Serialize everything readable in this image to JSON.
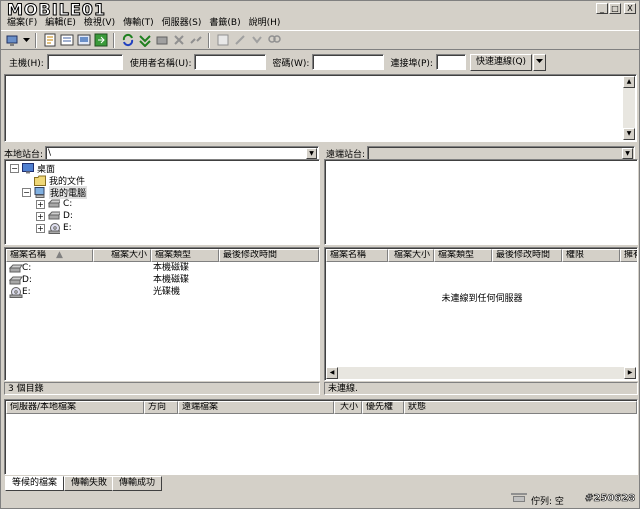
{
  "window": {
    "logo": "MOBILE01",
    "controls": [
      "_",
      "□",
      "X"
    ]
  },
  "menu": [
    "檔案(F)",
    "編輯(E)",
    "檢視(V)",
    "傳輸(T)",
    "伺服器(S)",
    "書籤(B)",
    "說明(H)"
  ],
  "quickconnect": {
    "host_label": "主機(H):",
    "user_label": "使用者名稱(U):",
    "pass_label": "密碼(W):",
    "port_label": "連接埠(P):",
    "connect_button": "快速連線(Q)"
  },
  "local": {
    "site_label": "本地站台:",
    "path": "\\",
    "tree": [
      {
        "label": "桌面",
        "icon": "desktop-icon",
        "expander": "⊟"
      },
      {
        "label": "我的文件",
        "icon": "folder-icon",
        "expander": ""
      },
      {
        "label": "我的電腦",
        "icon": "computer-icon",
        "expander": "⊟"
      },
      {
        "label": "C:",
        "icon": "drive-icon",
        "expander": "+"
      },
      {
        "label": "D:",
        "icon": "drive-icon",
        "expander": "+"
      },
      {
        "label": "E:",
        "icon": "cdrom-icon",
        "expander": "+"
      }
    ],
    "columns": [
      "檔案名稱",
      "檔案大小",
      "檔案類型",
      "最後修改時間"
    ],
    "files": [
      {
        "name": "C:",
        "type": "本機磁碟"
      },
      {
        "name": "D:",
        "type": "本機磁碟"
      },
      {
        "name": "E:",
        "type": "光碟機"
      }
    ],
    "status": "3 個目錄"
  },
  "remote": {
    "site_label": "遠端站台:",
    "columns": [
      "檔案名稱",
      "檔案大小",
      "檔案類型",
      "最後修改時間",
      "權限",
      "擁有"
    ],
    "empty_message": "未連線到任何伺服器",
    "status": "未連線."
  },
  "queue": {
    "columns": [
      "伺服器/本地檔案",
      "方向",
      "遠端檔案",
      "大小",
      "優先權",
      "狀態"
    ],
    "tabs": [
      "等候的檔案",
      "傳輸失敗",
      "傳輸成功"
    ]
  },
  "statusbar": {
    "queue_label": "佇列: 空",
    "watermark": "#250628"
  }
}
